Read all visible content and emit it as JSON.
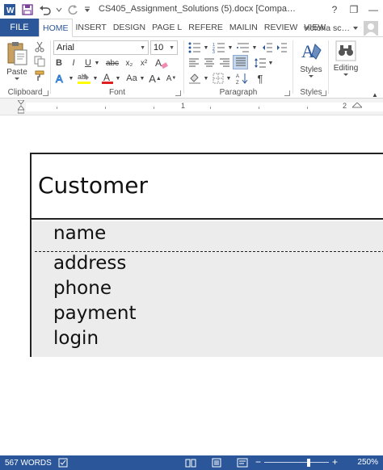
{
  "title_bar": {
    "document_title": "CS405_Assignment_Solutions (5).docx [Compa…",
    "help_label": "?",
    "restore_label": "❐",
    "minimize_label": "—"
  },
  "tabs": {
    "file": "FILE",
    "items": [
      "HOME",
      "INSERT",
      "DESIGN",
      "PAGE L",
      "REFERE",
      "MAILIN",
      "REVIEW",
      "VIEW"
    ],
    "active": "HOME"
  },
  "user": {
    "name": "victoria sc…"
  },
  "ribbon": {
    "clipboard": {
      "label": "Clipboard",
      "paste_label": "Paste"
    },
    "font": {
      "label": "Font",
      "font_name": "Arial",
      "font_size": "10",
      "bold": "B",
      "italic": "I",
      "underline": "U",
      "strikethrough": "abc",
      "subscript": "x₂",
      "superscript": "x²",
      "clear_format": "A",
      "text_effects": "A",
      "highlight": "ab",
      "font_color": "A",
      "change_case": "Aa",
      "grow": "A",
      "shrink": "A"
    },
    "paragraph": {
      "label": "Paragraph",
      "pilcrow": "¶"
    },
    "styles": {
      "label": "Styles",
      "button": "Styles"
    },
    "editing": {
      "button": "Editing"
    }
  },
  "ruler": {
    "marks": [
      "1",
      "2"
    ]
  },
  "document": {
    "uml_class": {
      "name": "Customer",
      "attributes": [
        "name",
        "address",
        "phone",
        "payment",
        "login"
      ]
    }
  },
  "status_bar": {
    "word_count": "567 WORDS",
    "zoom_minus": "−",
    "zoom_plus": "+",
    "zoom_percent": "250%",
    "zoom_level": 250
  },
  "colors": {
    "accent": "#2b579a",
    "highlight_yellow": "#ffff00",
    "font_red": "#e02020",
    "table_fill": "#ececec"
  }
}
